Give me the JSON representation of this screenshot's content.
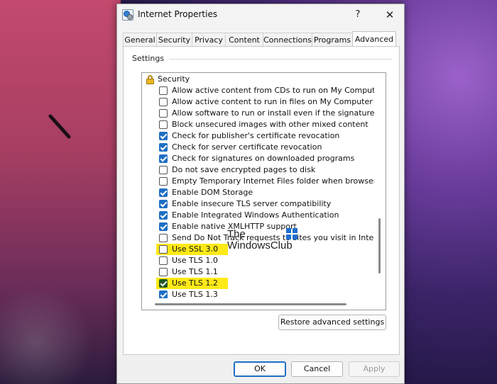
{
  "window": {
    "title": "Internet Properties",
    "help_glyph": "?",
    "close_glyph": "✕"
  },
  "tabs": [
    "General",
    "Security",
    "Privacy",
    "Content",
    "Connections",
    "Programs",
    "Advanced"
  ],
  "active_tab": "Advanced",
  "settings_label": "Settings",
  "list": {
    "heading": "Security",
    "items": [
      {
        "label": "Allow active content from CDs to run on My Computer",
        "checked": false,
        "highlighted": false
      },
      {
        "label": "Allow active content to run in files on My Computer",
        "checked": false,
        "highlighted": false
      },
      {
        "label": "Allow software to run or install even if the signature is inva",
        "checked": false,
        "highlighted": false
      },
      {
        "label": "Block unsecured images with other mixed content",
        "checked": false,
        "highlighted": false
      },
      {
        "label": "Check for publisher's certificate revocation",
        "checked": true,
        "highlighted": false
      },
      {
        "label": "Check for server certificate revocation",
        "checked": true,
        "highlighted": false
      },
      {
        "label": "Check for signatures on downloaded programs",
        "checked": true,
        "highlighted": false
      },
      {
        "label": "Do not save encrypted pages to disk",
        "checked": false,
        "highlighted": false
      },
      {
        "label": "Empty Temporary Internet Files folder when browser is clo",
        "checked": false,
        "highlighted": false
      },
      {
        "label": "Enable DOM Storage",
        "checked": true,
        "highlighted": false
      },
      {
        "label": "Enable insecure TLS server compatibility",
        "checked": true,
        "highlighted": false
      },
      {
        "label": "Enable Integrated Windows Authentication",
        "checked": true,
        "highlighted": false
      },
      {
        "label": "Enable native XMLHTTP support",
        "checked": true,
        "highlighted": false
      },
      {
        "label": "Send Do Not Track requests to sites you visit in Internet E",
        "checked": false,
        "highlighted": false
      },
      {
        "label": "Use SSL 3.0",
        "checked": false,
        "highlighted": true
      },
      {
        "label": "Use TLS 1.0",
        "checked": false,
        "highlighted": false
      },
      {
        "label": "Use TLS 1.1",
        "checked": false,
        "highlighted": false
      },
      {
        "label": "Use TLS 1.2",
        "checked": true,
        "highlighted": true
      },
      {
        "label": "Use TLS 1.3",
        "checked": true,
        "highlighted": false
      }
    ]
  },
  "watermark": {
    "line1": "The",
    "line2": "WindowsClub"
  },
  "buttons": {
    "restore": "Restore advanced settings",
    "ok": "OK",
    "cancel": "Cancel",
    "apply": "Apply"
  },
  "colors": {
    "accent": "#1f6fc4",
    "highlight": "#ffe918",
    "tls12_check": "#1f5a1f"
  }
}
